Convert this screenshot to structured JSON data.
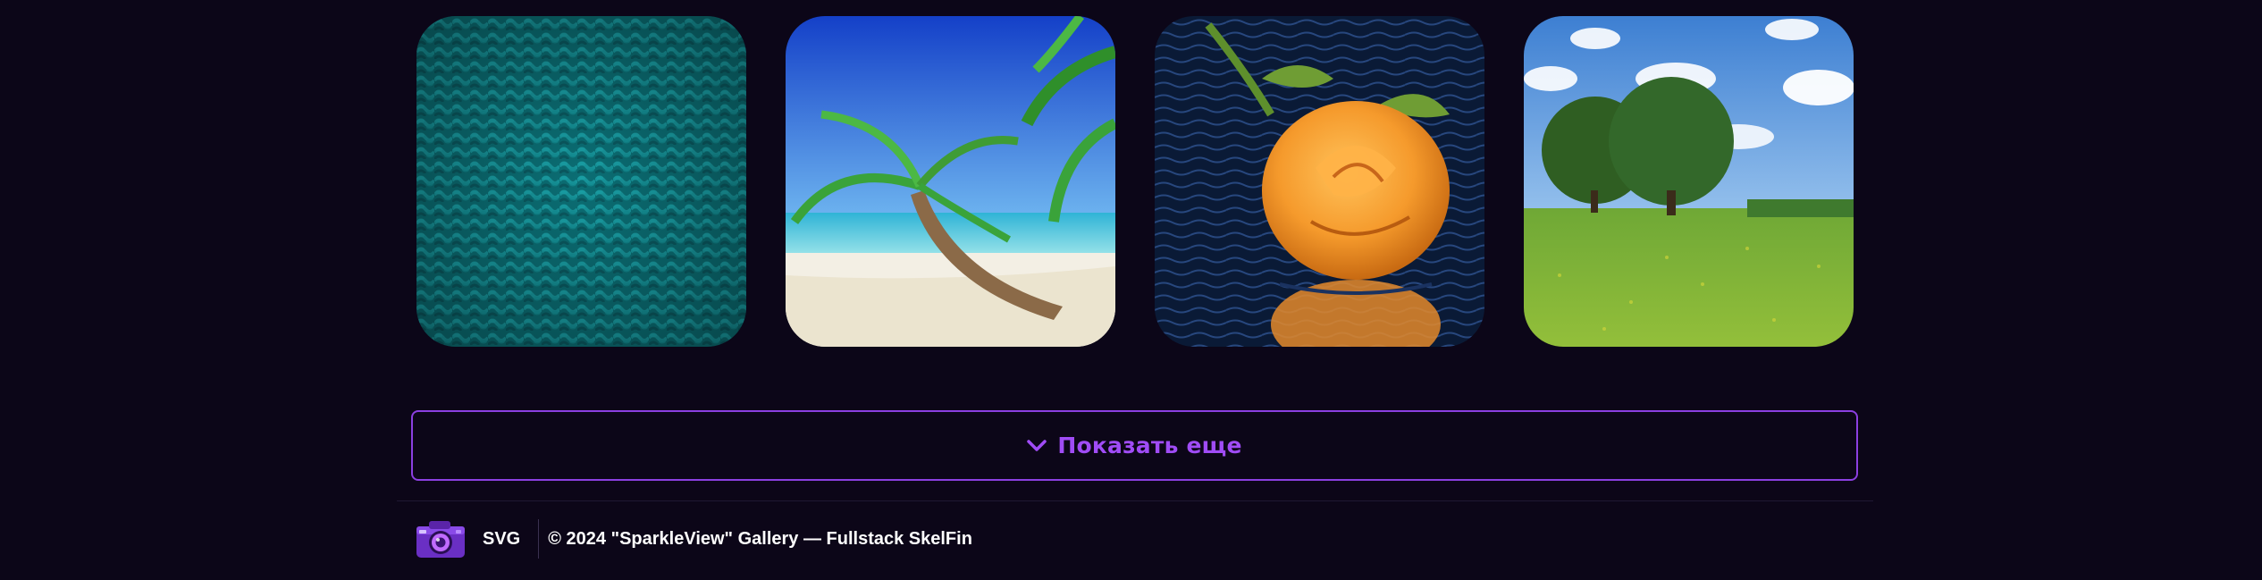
{
  "gallery": {
    "images": [
      {
        "subject": "teal knitted fabric texture"
      },
      {
        "subject": "palm tree on tropical beach"
      },
      {
        "subject": "orange rose reflected in water"
      },
      {
        "subject": "trees on green meadow under blue sky"
      }
    ]
  },
  "load_more": {
    "icon": "chevron-down-icon",
    "label": "Показать еще"
  },
  "footer": {
    "logo_icon": "camera-icon",
    "svg_label": "SVG",
    "copyright": "© 2024 \"SparkleView\" Gallery — Fullstack SkelFin"
  },
  "colors": {
    "background": "#0c0618",
    "accent": "#8b3fe0",
    "accent_text": "#a04cf6",
    "footer_text": "#ffffff"
  }
}
